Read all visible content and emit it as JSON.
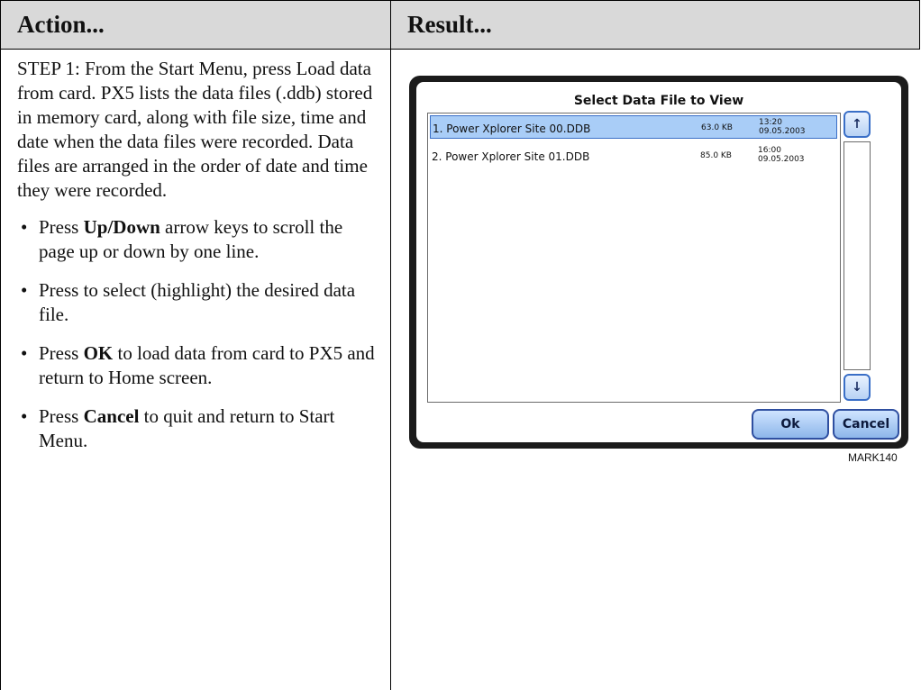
{
  "header": {
    "action": "Action...",
    "result": "Result..."
  },
  "action": {
    "step": "STEP 1: From the Start Menu, press Load data from card. PX5 lists the data files (.ddb) stored in memory card, along with file size, time and date when the data files were recorded. Data files are arranged in the order of date and time they were recorded.",
    "bullets": [
      {
        "pre": "Press ",
        "bold": "Up/Down",
        "post": " arrow keys to scroll the page up or down by one line."
      },
      {
        "pre": "Press to select (highlight) the desired data file.",
        "bold": "",
        "post": ""
      },
      {
        "pre": "Press ",
        "bold": "OK",
        "post": " to load data from card to PX5 and return to Home screen."
      },
      {
        "pre": "Press ",
        "bold": "Cancel",
        "post": " to quit and return to Start Menu."
      }
    ]
  },
  "screen": {
    "title": "Select Data File to View",
    "files": [
      {
        "name": "1. Power Xplorer Site 00.DDB",
        "size": "63.0 KB",
        "time": "13:20",
        "date": "09.05.2003",
        "selected": true
      },
      {
        "name": "2. Power Xplorer Site 01.DDB",
        "size": "85.0 KB",
        "time": "16:00",
        "date": "09.05.2003",
        "selected": false
      }
    ],
    "scroll_up": "↑",
    "scroll_down": "↓",
    "ok_label": "Ok",
    "cancel_label": "Cancel",
    "colors": {
      "selected_row": "#a9cdf7",
      "button_border": "#2f4fa0"
    }
  },
  "caption": "MARK140"
}
